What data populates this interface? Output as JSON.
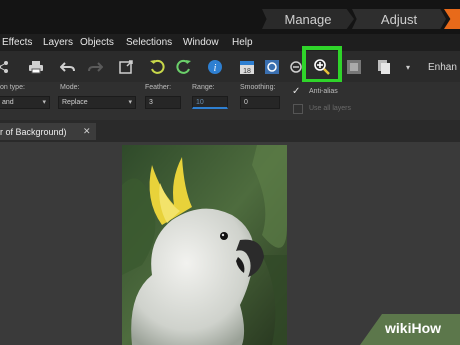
{
  "workspace_tabs": {
    "manage": "Manage",
    "adjust": "Adjust"
  },
  "menu": [
    "Effects",
    "Layers",
    "Objects",
    "Selections",
    "Window",
    "Help"
  ],
  "toolbar": {
    "enhance_label": "Enhan"
  },
  "options": {
    "selection_type_label": "on type:",
    "selection_type_value": "and",
    "mode_label": "Mode:",
    "mode_value": "Replace",
    "feather_label": "Feather:",
    "feather_value": "3",
    "range_label": "Range:",
    "range_value": "10",
    "smoothing_label": "Smoothing:",
    "smoothing_value": "0",
    "antialias_label": "Anti-alias",
    "use_all_layers_label": "Use all layers"
  },
  "document_tab": {
    "title": "r of Background)",
    "close": "✕"
  },
  "watermark": {
    "text": "wikiHow"
  },
  "colors": {
    "highlight": "#2fd42a",
    "accent": "#e86a1a"
  },
  "icons": [
    "share-icon",
    "print-icon",
    "undo-icon",
    "redo-icon",
    "crop-icon",
    "rotate-left-icon",
    "rotate-right-icon",
    "info-icon",
    "calendar-icon",
    "smart-photo-icon",
    "zoom-out-icon",
    "zoom-in-icon",
    "photo-frame-icon",
    "copy-icon",
    "chevron-down-icon"
  ]
}
